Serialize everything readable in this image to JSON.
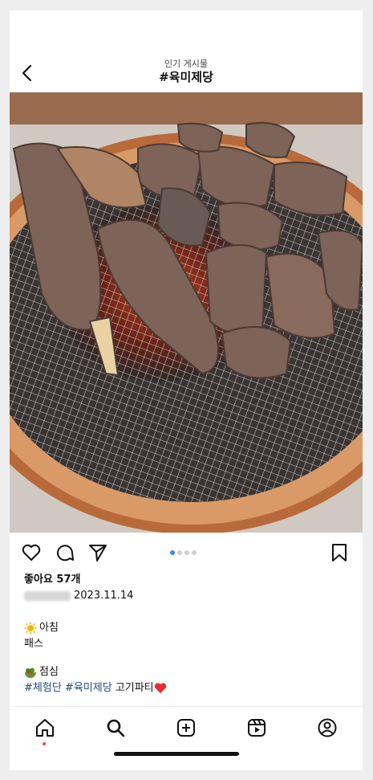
{
  "header": {
    "subtitle": "인기 게시물",
    "title": "#육미제당"
  },
  "carousel": {
    "count": 4,
    "active_index": 0
  },
  "post": {
    "likes": "좋아요 57개",
    "date": "2023.11.14",
    "breakfast_label": "아침",
    "breakfast_text": "패스",
    "lunch_label": "점심",
    "hashtag1": "#체험단",
    "hashtag2": "#육미제당",
    "caption_tail": "고기파티"
  },
  "icons": {
    "back": "back-arrow-icon",
    "like": "heart-icon",
    "comment": "comment-icon",
    "share": "send-icon",
    "save": "bookmark-icon",
    "sun": "sun-emoji",
    "salad": "salad-emoji",
    "heart_emoji": "red-heart-emoji",
    "home": "home-icon",
    "search": "search-icon",
    "create": "plus-square-icon",
    "reels": "reels-icon",
    "profile": "profile-icon"
  },
  "colors": {
    "hashtag": "#22497e",
    "active_dot": "#2f8ff0",
    "notification": "#ed4956",
    "grill_copper": "#b86a3b"
  }
}
